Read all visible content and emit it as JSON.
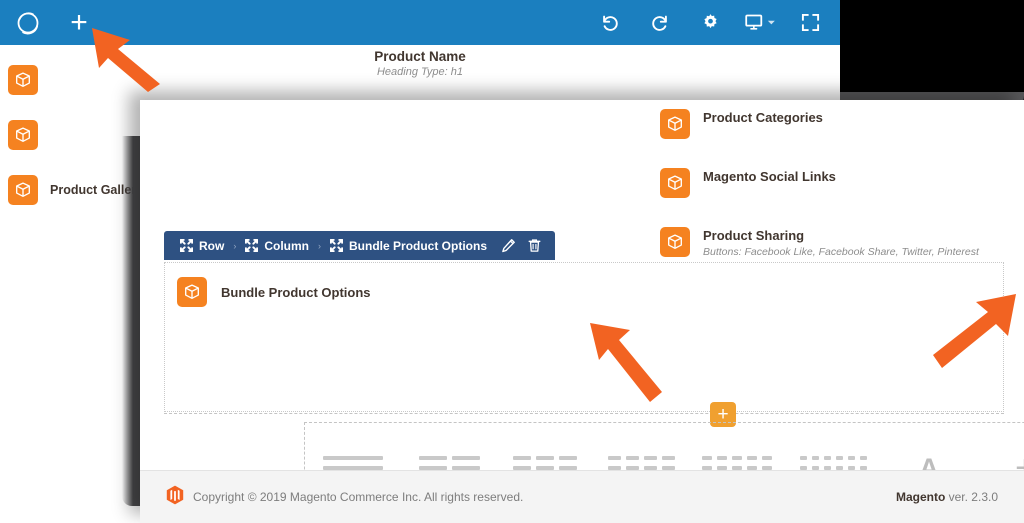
{
  "app": {
    "accent_blue": "#1b7fbf",
    "accent_orange": "#f58220",
    "breadcrumb_navy": "#2e5182",
    "annotation_orange": "#f26322"
  },
  "topbar": {
    "logo_icon": "page-builder-ring-logo",
    "add_label": "+",
    "tools": [
      {
        "name": "undo-icon",
        "label": "Undo"
      },
      {
        "name": "redo-icon",
        "label": "Redo"
      },
      {
        "name": "gear-icon",
        "label": "Settings"
      },
      {
        "name": "desktop-icon",
        "label": "Viewport"
      },
      {
        "name": "fullscreen-icon",
        "label": "Full Screen"
      }
    ]
  },
  "stage": {
    "heading_title": "Product Name",
    "heading_sub": "Heading Type: h1",
    "rail_items": [
      {
        "icon": "package-icon",
        "label": ""
      },
      {
        "icon": "package-icon",
        "label": ""
      },
      {
        "icon": "package-icon",
        "label": "Product Gallery"
      }
    ]
  },
  "panel": {
    "items": [
      {
        "icon": "package-icon",
        "title": "Product Categories",
        "sub": ""
      },
      {
        "icon": "package-icon",
        "title": "Magento Social Links",
        "sub": ""
      },
      {
        "icon": "package-icon",
        "title": "Product Sharing",
        "sub": "Buttons: Facebook Like, Facebook Share, Twitter, Pinterest"
      }
    ]
  },
  "breadcrumb": {
    "segments": [
      {
        "icon": "move-icon",
        "label": "Row"
      },
      {
        "icon": "move-icon",
        "label": "Column"
      },
      {
        "icon": "move-icon",
        "label": "Bundle Product Options"
      }
    ],
    "separator": "›",
    "edit_label": "Edit",
    "delete_label": "Delete"
  },
  "content_block": {
    "icon": "package-icon",
    "title": "Bundle Product Options"
  },
  "add_inline": {
    "label": "+"
  },
  "layout_options": [
    {
      "name": "layout-1-column",
      "columns": 1,
      "segments": 1
    },
    {
      "name": "layout-2-column",
      "columns": 2,
      "segments": 1
    },
    {
      "name": "layout-3-column",
      "columns": 3,
      "segments": 1
    },
    {
      "name": "layout-4-column",
      "columns": 4,
      "segments": 1
    },
    {
      "name": "layout-5-column",
      "columns": 5,
      "segments": 1
    },
    {
      "name": "layout-6-column",
      "columns": 6,
      "segments": 1
    },
    {
      "name": "text-element",
      "glyph": "A"
    },
    {
      "name": "add-element",
      "glyph": "+"
    }
  ],
  "footer": {
    "logo_icon": "magento-logo-icon",
    "copyright": "Copyright © 2019 Magento Commerce Inc. All rights reserved.",
    "product_name": "Magento",
    "version_text": " ver. 2.3.0"
  },
  "annotations": [
    {
      "name": "arrow-to-add-root-button"
    },
    {
      "name": "arrow-to-inline-add-button"
    },
    {
      "name": "arrow-to-add-element-button"
    }
  ]
}
